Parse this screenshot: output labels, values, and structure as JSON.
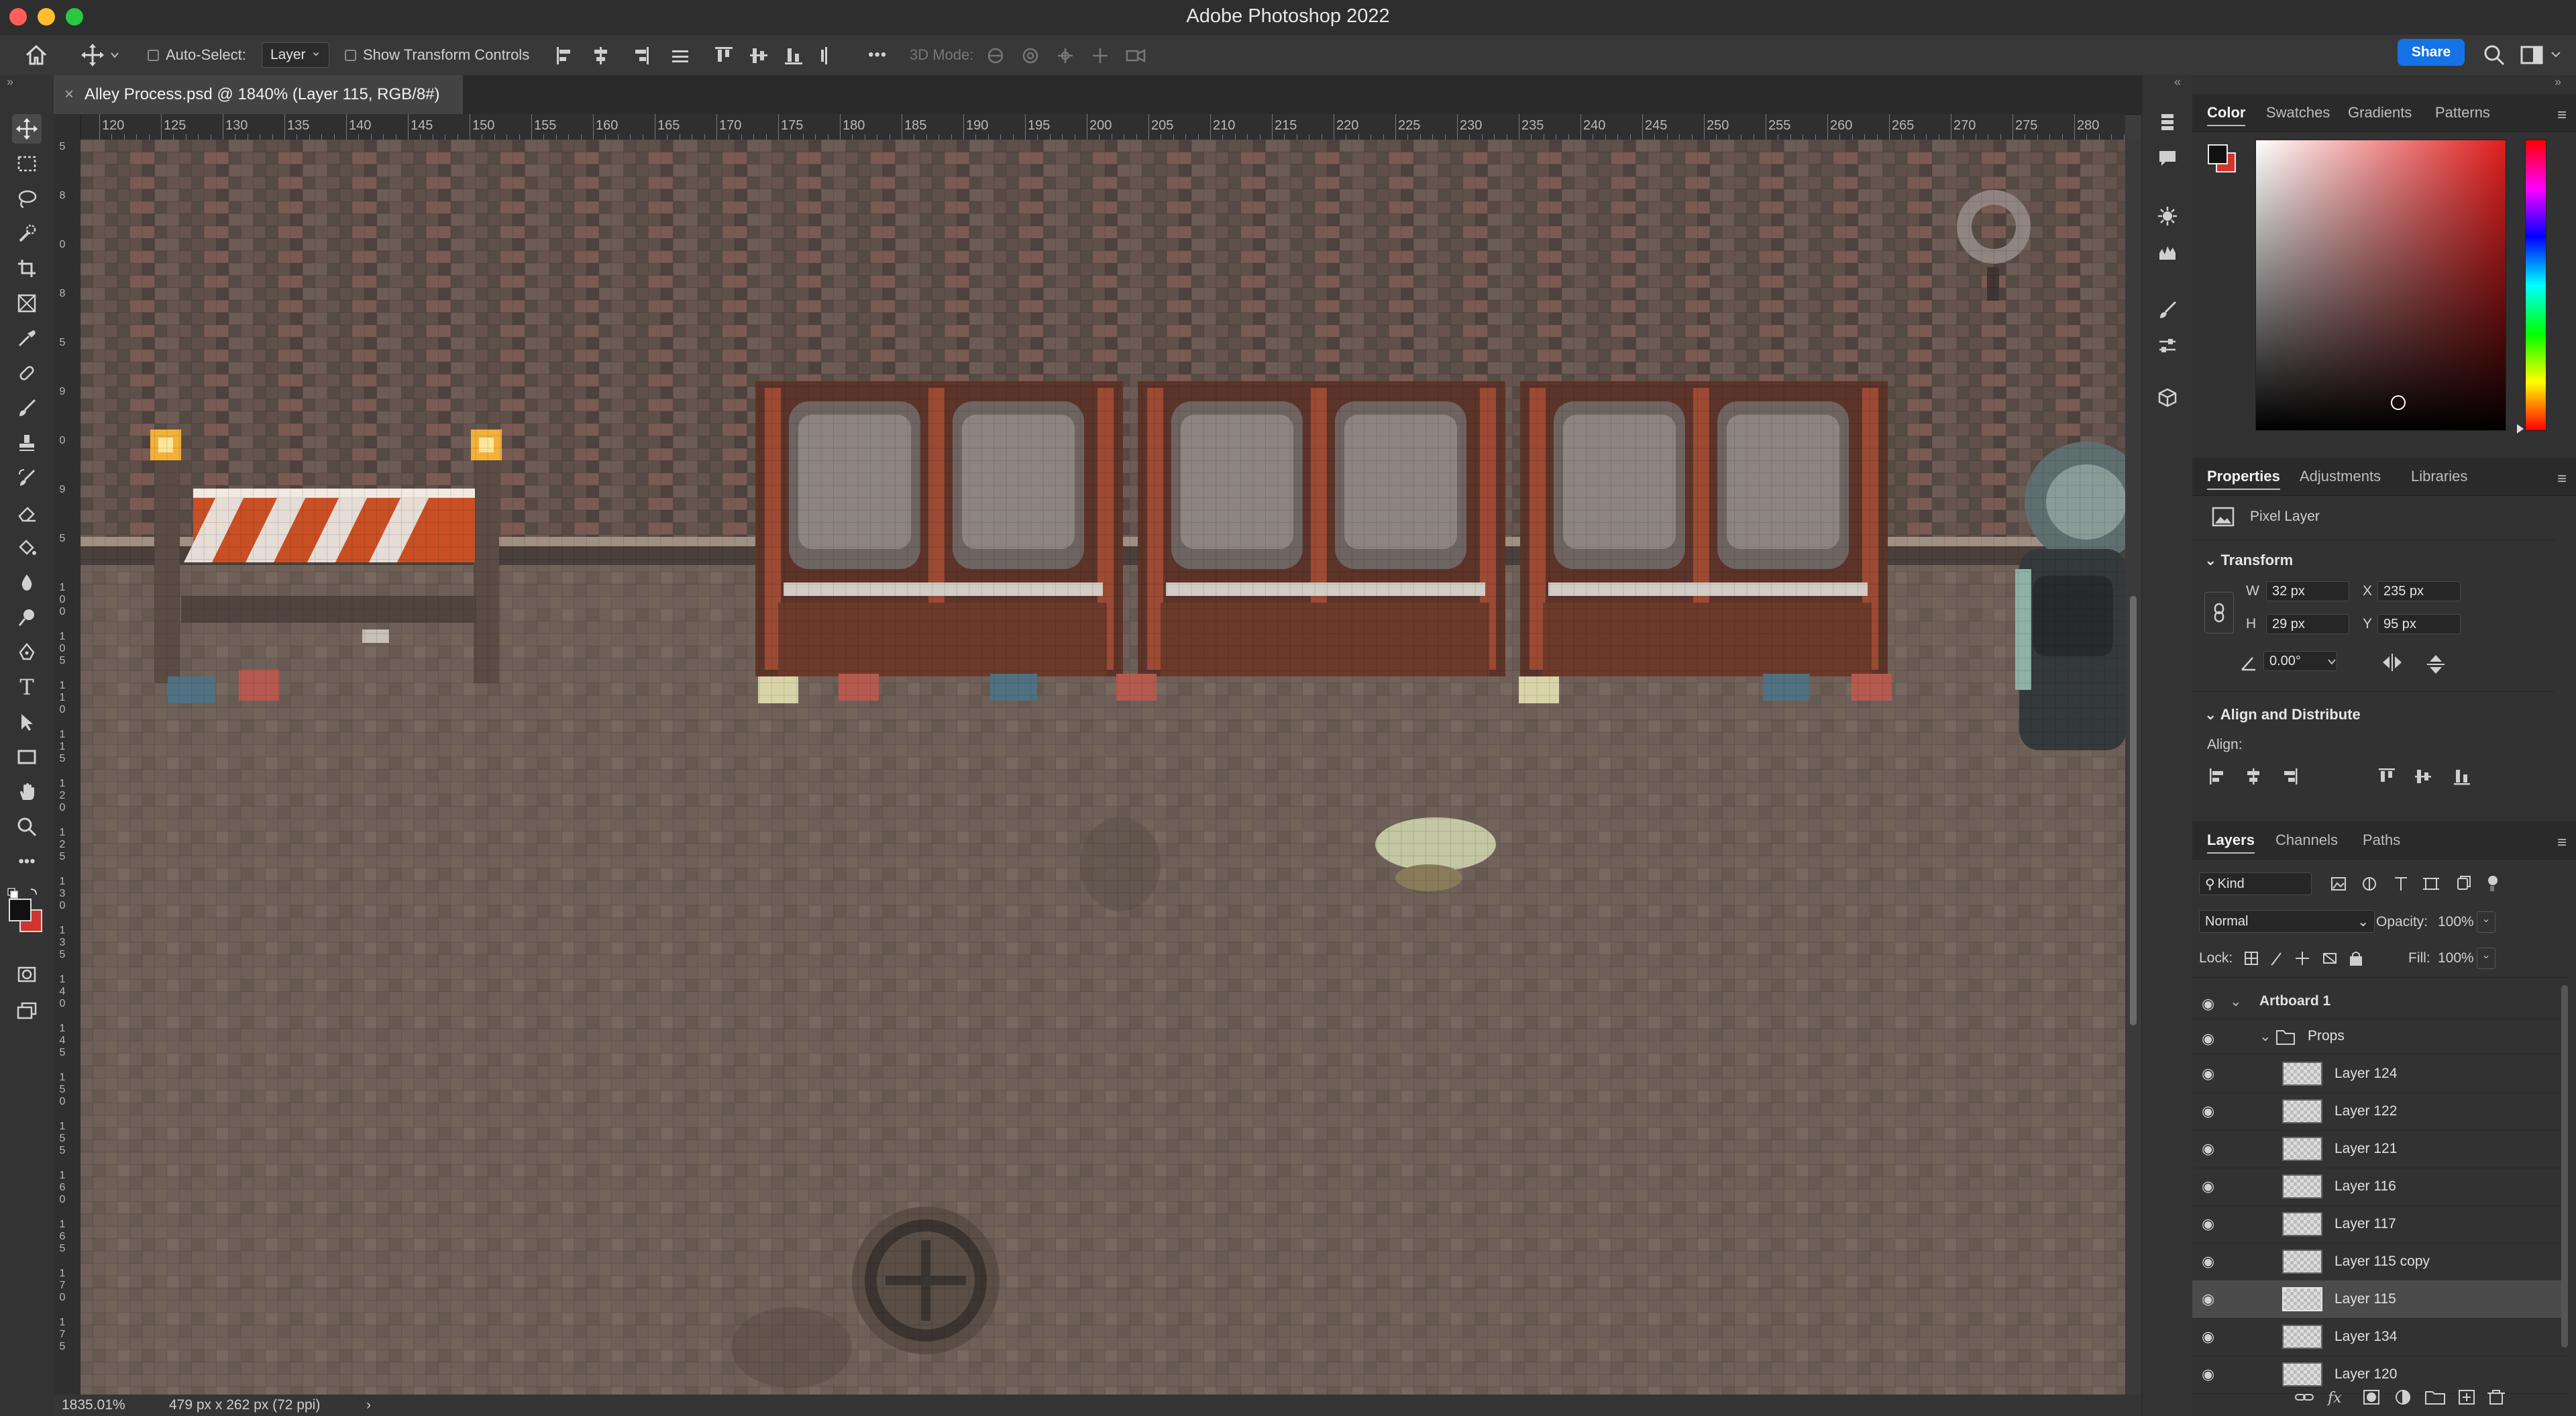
{
  "window": {
    "app_title": "Adobe Photoshop 2022"
  },
  "options_bar": {
    "auto_select_label": "Auto-Select:",
    "auto_select_value": "Layer",
    "show_transform_label": "Show Transform Controls",
    "mode_3d_label": "3D Mode:",
    "more_label": "•••",
    "share_label": "Share"
  },
  "document": {
    "tab_title": "Alley Process.psd @ 1840% (Layer 115, RGB/8#)",
    "close_glyph": "×"
  },
  "rulers": {
    "top_labels": [
      "120",
      "125",
      "130",
      "135",
      "140",
      "145",
      "150",
      "155",
      "160",
      "165",
      "170",
      "175",
      "180",
      "185",
      "190",
      "195",
      "200",
      "205",
      "210",
      "215",
      "220",
      "225",
      "230",
      "235",
      "240",
      "245",
      "250",
      "255",
      "260",
      "265",
      "270",
      "275",
      "280"
    ],
    "left_labels": [
      "5",
      "8",
      "0",
      "8",
      "5",
      "9",
      "0",
      "9",
      "5",
      "1 0 0",
      "1 0 5",
      "1 1 0",
      "1 1 5",
      "1 2 0",
      "1 2 5",
      "1 3 0",
      "1 3 5",
      "1 4 0",
      "1 4 5",
      "1 5 0",
      "1 5 5",
      "1 6 0",
      "1 6 5",
      "1 7 0",
      "1 7 5"
    ]
  },
  "status_bar": {
    "zoom": "1835.01%",
    "doc_size": "479 px x 262 px (72 ppi)",
    "more_glyph": "›"
  },
  "color_panel": {
    "tabs": [
      "Color",
      "Swatches",
      "Gradients",
      "Patterns"
    ],
    "active_tab": "Color",
    "foreground": "#111111",
    "background": "#d0342c",
    "picker_hue": "#e11d1d"
  },
  "properties_panel": {
    "tabs": [
      "Properties",
      "Adjustments",
      "Libraries"
    ],
    "layer_type": "Pixel Layer",
    "transform_title": "Transform",
    "w_label": "W",
    "w_value": "32 px",
    "h_label": "H",
    "h_value": "29 px",
    "x_label": "X",
    "x_value": "235 px",
    "y_label": "Y",
    "y_value": "95 px",
    "angle_value": "0.00°",
    "align_title": "Align and Distribute",
    "align_label": "Align:"
  },
  "layers_panel": {
    "tabs": [
      "Layers",
      "Channels",
      "Paths"
    ],
    "filter_kind": "Kind",
    "blend_mode": "Normal",
    "opacity_label": "Opacity:",
    "opacity_value": "100%",
    "lock_label": "Lock:",
    "fill_label": "Fill:",
    "fill_value": "100%",
    "artboard": "Artboard 1",
    "group": "Props",
    "layers": [
      {
        "name": "Layer 124",
        "selected": false
      },
      {
        "name": "Layer 122",
        "selected": false
      },
      {
        "name": "Layer 121",
        "selected": false
      },
      {
        "name": "Layer 116",
        "selected": false
      },
      {
        "name": "Layer 117",
        "selected": false
      },
      {
        "name": "Layer 115 copy",
        "selected": false
      },
      {
        "name": "Layer 115",
        "selected": true
      },
      {
        "name": "Layer 134",
        "selected": false
      },
      {
        "name": "Layer 120",
        "selected": false
      }
    ],
    "footer_fx": "fx"
  }
}
